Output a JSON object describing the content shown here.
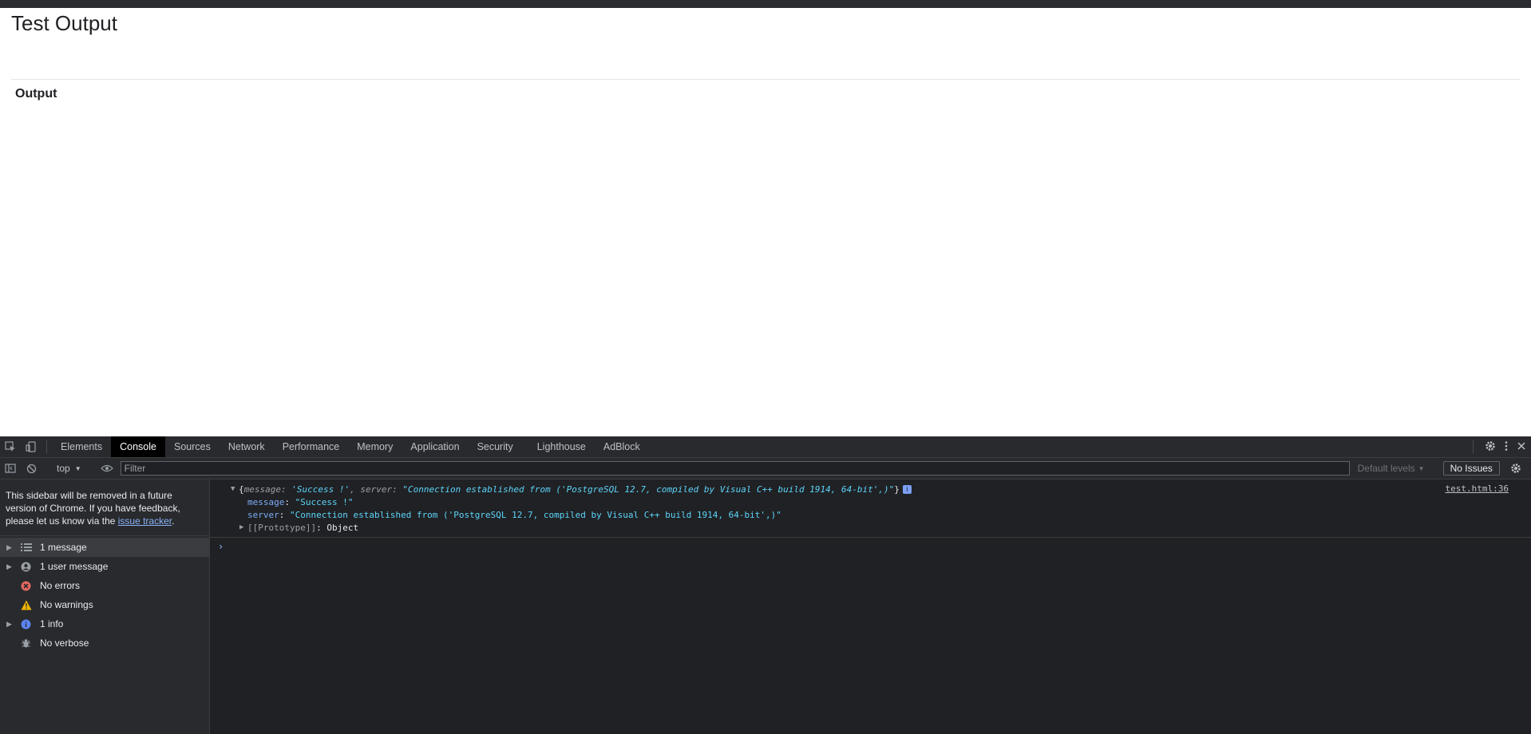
{
  "page": {
    "title": "Test Output",
    "output_heading": "Output"
  },
  "devtools": {
    "tabs": [
      {
        "label": "Elements"
      },
      {
        "label": "Console",
        "active": true
      },
      {
        "label": "Sources"
      },
      {
        "label": "Network"
      },
      {
        "label": "Performance"
      },
      {
        "label": "Memory"
      },
      {
        "label": "Application"
      },
      {
        "label": "Security"
      },
      {
        "label": "Lighthouse"
      },
      {
        "label": "AdBlock"
      }
    ],
    "toolbar": {
      "context": "top",
      "filter_placeholder": "Filter",
      "levels": "Default levels",
      "issues": "No Issues"
    },
    "sidebar": {
      "notice_text": "This sidebar will be removed in a future version of Chrome. If you have feedback, please let us know via the ",
      "notice_link": "issue tracker",
      "notice_end": ".",
      "items": [
        {
          "label": "1 message",
          "icon": "list-icon"
        },
        {
          "label": "1 user message",
          "icon": "user-icon"
        },
        {
          "label": "No errors",
          "icon": "error-icon"
        },
        {
          "label": "No warnings",
          "icon": "warning-icon"
        },
        {
          "label": "1 info",
          "icon": "info-icon"
        },
        {
          "label": "No verbose",
          "icon": "bug-icon"
        }
      ]
    },
    "console": {
      "summary": {
        "open": "{",
        "message_key": "message",
        "message_value": "'Success !'",
        "sep": ", ",
        "server_key": "server",
        "server_value": "\"Connection established from ('PostgreSQL 12.7, compiled by Visual C++ build 1914, 64-bit',)\"",
        "close": "}"
      },
      "props": [
        {
          "key": "message",
          "value": "\"Success !\""
        },
        {
          "key": "server",
          "value": "\"Connection established from ('PostgreSQL 12.7, compiled by Visual C++ build 1914, 64-bit',)\""
        }
      ],
      "prototype_key": "[[Prototype]]",
      "prototype_value": "Object",
      "source": "test.html:36",
      "colon": ": ",
      "prompt": "›",
      "info_badge": "i"
    }
  }
}
